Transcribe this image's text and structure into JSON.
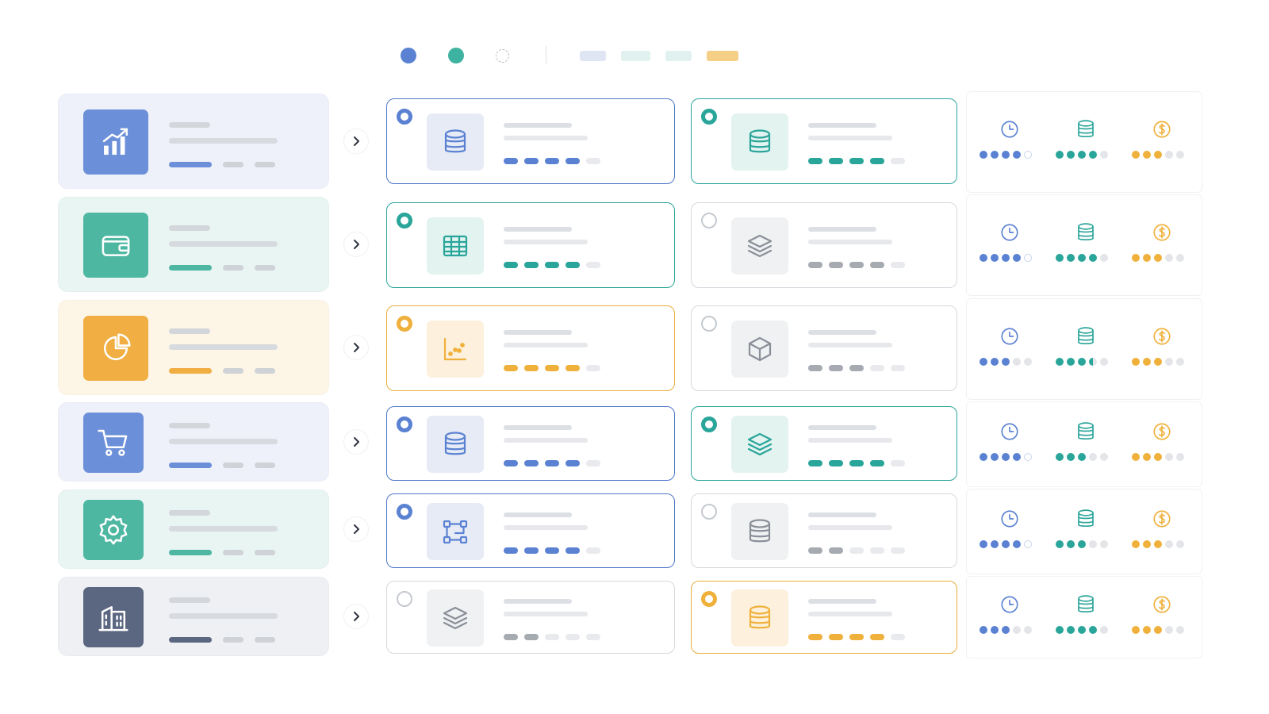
{
  "colors": {
    "blue": "#5b82d2",
    "teal": "#2aa59a",
    "amber": "#efb13c",
    "slate": "#5c6880",
    "grey": "#9a9ea6"
  },
  "legend": {
    "dots": [
      "blue",
      "teal",
      "empty"
    ],
    "pills": [
      "#dfe5f3",
      "#e0f1ef",
      "#e0f1ef",
      "#f5cf86"
    ]
  },
  "sources": [
    {
      "icon": "trending-chart-icon",
      "accent": "blue"
    },
    {
      "icon": "wallet-icon",
      "accent": "teal"
    },
    {
      "icon": "pie-chart-icon",
      "accent": "amber"
    },
    {
      "icon": "shopping-cart-icon",
      "accent": "blue"
    },
    {
      "icon": "gear-icon",
      "accent": "teal"
    },
    {
      "icon": "building-icon",
      "accent": "slate"
    }
  ],
  "options": [
    [
      {
        "icon": "database-icon",
        "accent": "blue",
        "selected": true,
        "level": 4
      },
      {
        "icon": "database-icon",
        "accent": "teal",
        "selected": true,
        "level": 4
      }
    ],
    [
      {
        "icon": "table-icon",
        "accent": "teal",
        "selected": true,
        "level": 4
      },
      {
        "icon": "layers-icon",
        "accent": "grey",
        "selected": false,
        "level": 4
      }
    ],
    [
      {
        "icon": "scatter-plot-icon",
        "accent": "amber",
        "selected": true,
        "level": 4
      },
      {
        "icon": "cube-icon",
        "accent": "grey",
        "selected": false,
        "level": 3
      }
    ],
    [
      {
        "icon": "database-icon",
        "accent": "blue",
        "selected": true,
        "level": 4
      },
      {
        "icon": "layers-icon",
        "accent": "teal",
        "selected": true,
        "level": 4
      }
    ],
    [
      {
        "icon": "network-icon",
        "accent": "blue",
        "selected": true,
        "level": 4
      },
      {
        "icon": "database-icon",
        "accent": "grey",
        "selected": false,
        "level": 2
      }
    ],
    [
      {
        "icon": "layers-icon",
        "accent": "grey",
        "selected": false,
        "level": 2
      },
      {
        "icon": "database-icon",
        "accent": "amber",
        "selected": true,
        "level": 4
      }
    ]
  ],
  "metrics": [
    {
      "time": 4,
      "storage": 4,
      "cost": 3
    },
    {
      "time": 4,
      "storage": 4,
      "cost": 3
    },
    {
      "time": 3,
      "storage": 3.5,
      "cost": 3
    },
    {
      "time": 4,
      "storage": 3,
      "cost": 3
    },
    {
      "time": 4,
      "storage": 3,
      "cost": 3
    },
    {
      "time": 3,
      "storage": 4,
      "cost": 3
    }
  ],
  "metric_icons": [
    "clock-icon",
    "database-icon",
    "dollar-coin-icon"
  ]
}
